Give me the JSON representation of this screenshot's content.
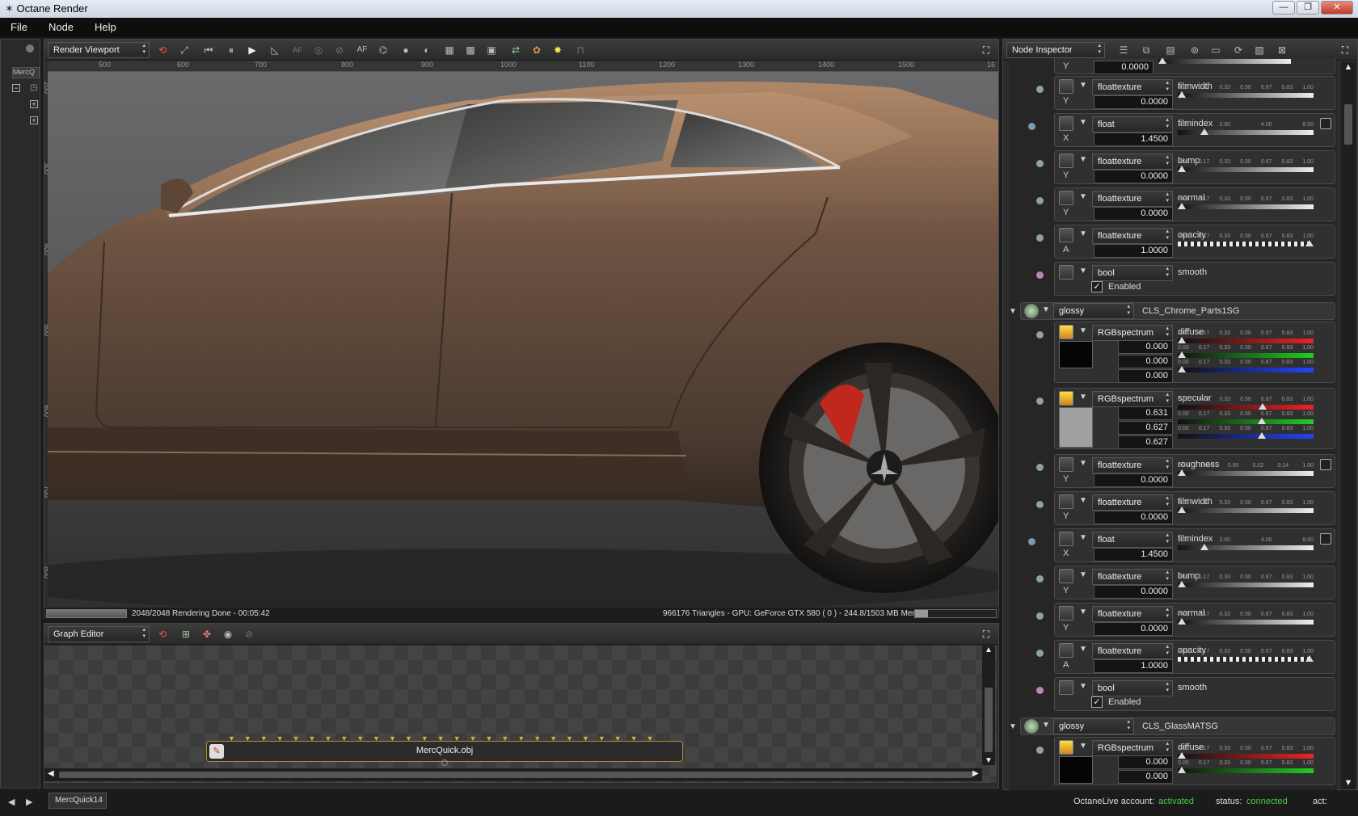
{
  "app": {
    "title": "Octane Render",
    "min": "—",
    "max": "❐",
    "close": "✕"
  },
  "menu": [
    "File",
    "Node",
    "Help"
  ],
  "render_viewport": {
    "dropdown": "Render Viewport",
    "ruler_h": [
      "500",
      "600",
      "700",
      "800",
      "900",
      "1000",
      "1100",
      "1200",
      "1300",
      "1400",
      "1500",
      "16"
    ],
    "ruler_v": [
      "200",
      "300",
      "400",
      "500",
      "600",
      "700",
      "800"
    ],
    "status_left": "2048/2048 Rendering Done - 00:05:42",
    "status_right": "966176 Triangles - GPU: GeForce GTX 580 ( 0 ) - 244.8/1503 MB Mem Used",
    "progress": 1.0,
    "toolbar_text": [
      "AF",
      "AF"
    ]
  },
  "graph_editor": {
    "dropdown": "Graph Editor",
    "node_label": "MercQuick.obj"
  },
  "left_tabs": {
    "scene_tab": "MercQ",
    "bottom_tab": "MercQuick14"
  },
  "node_inspector": {
    "dropdown": "Node Inspector",
    "top_partial": {
      "axis": "Y",
      "value": "0.0000"
    },
    "rows": [
      {
        "type": "floattexture",
        "name": "filmwidth",
        "axis": "Y",
        "value": "0.0000",
        "ticks": [
          "0.00",
          "0.17",
          "0.33",
          "0.50",
          "0.67",
          "0.83",
          "1.00"
        ],
        "pos": 0
      },
      {
        "type": "float",
        "name": "filmindex",
        "axis": "X",
        "value": "1.4500",
        "ticks": [
          "1.00",
          "2.00",
          "4.00",
          "8.00"
        ],
        "pos": 0.18,
        "curve": true
      },
      {
        "type": "floattexture",
        "name": "bump",
        "axis": "Y",
        "value": "0.0000",
        "ticks": [
          "0.00",
          "0.17",
          "0.33",
          "0.50",
          "0.67",
          "0.83",
          "1.00"
        ],
        "pos": 0
      },
      {
        "type": "floattexture",
        "name": "normal",
        "axis": "Y",
        "value": "0.0000",
        "ticks": [
          "0.00",
          "0.17",
          "0.33",
          "0.50",
          "0.67",
          "0.83",
          "1.00"
        ],
        "pos": 0
      },
      {
        "type": "floattexture",
        "name": "opacity",
        "axis": "A",
        "value": "1.0000",
        "ticks": [
          "0.00",
          "0.17",
          "0.33",
          "0.50",
          "0.67",
          "0.83",
          "1.00"
        ],
        "pos": 1,
        "check": true
      },
      {
        "type": "bool",
        "name": "smooth",
        "checkbox": "Enabled"
      }
    ],
    "group1": {
      "type": "glossy",
      "name": "CLS_Chrome_Parts1SG"
    },
    "diffuse1": {
      "type": "RGBspectrum",
      "name": "diffuse",
      "values": [
        "0.000",
        "0.000",
        "0.000"
      ],
      "ticks": [
        "0.00",
        "0.17",
        "0.33",
        "0.50",
        "0.67",
        "0.83",
        "1.00"
      ],
      "color": "#050505"
    },
    "specular1": {
      "type": "RGBspectrum",
      "name": "specular",
      "values": [
        "0.631",
        "0.627",
        "0.627"
      ],
      "ticks": [
        "0.00",
        "0.17",
        "0.33",
        "0.50",
        "0.67",
        "0.83",
        "1.00"
      ],
      "color": "#a0a0a0"
    },
    "rows2": [
      {
        "type": "floattexture",
        "name": "roughness",
        "axis": "Y",
        "value": "0.0000",
        "ticks": [
          "0.00",
          "0.00",
          "0.00",
          "0.02",
          "0.14",
          "1.00"
        ],
        "pos": 0,
        "curve": true
      },
      {
        "type": "floattexture",
        "name": "filmwidth",
        "axis": "Y",
        "value": "0.0000",
        "ticks": [
          "0.00",
          "0.17",
          "0.33",
          "0.50",
          "0.67",
          "0.83",
          "1.00"
        ],
        "pos": 0
      },
      {
        "type": "float",
        "name": "filmindex",
        "axis": "X",
        "value": "1.4500",
        "ticks": [
          "1.00",
          "2.00",
          "4.00",
          "8.00"
        ],
        "pos": 0.18,
        "curve": true
      },
      {
        "type": "floattexture",
        "name": "bump",
        "axis": "Y",
        "value": "0.0000",
        "ticks": [
          "0.00",
          "0.17",
          "0.33",
          "0.50",
          "0.67",
          "0.83",
          "1.00"
        ],
        "pos": 0
      },
      {
        "type": "floattexture",
        "name": "normal",
        "axis": "Y",
        "value": "0.0000",
        "ticks": [
          "0.00",
          "0.17",
          "0.33",
          "0.50",
          "0.67",
          "0.83",
          "1.00"
        ],
        "pos": 0
      },
      {
        "type": "floattexture",
        "name": "opacity",
        "axis": "A",
        "value": "1.0000",
        "ticks": [
          "0.00",
          "0.17",
          "0.33",
          "0.50",
          "0.67",
          "0.83",
          "1.00"
        ],
        "pos": 1,
        "check": true
      },
      {
        "type": "bool",
        "name": "smooth",
        "checkbox": "Enabled"
      }
    ],
    "group2": {
      "type": "glossy",
      "name": "CLS_GlassMATSG"
    },
    "diffuse2": {
      "type": "RGBspectrum",
      "name": "diffuse",
      "values": [
        "0.000",
        "0.000"
      ],
      "ticks": [
        "0.00",
        "0.17",
        "0.33",
        "0.50",
        "0.67",
        "0.83",
        "1.00"
      ]
    }
  },
  "status_bar": {
    "account_label": "OctaneLive account:",
    "account_value": "activated",
    "status_label": "status:",
    "status_value": "connected",
    "act_label": "act:"
  },
  "colors": {
    "accent_green": "#44cc44",
    "car_paint": "#7a5a44",
    "brake": "#c0281e"
  }
}
